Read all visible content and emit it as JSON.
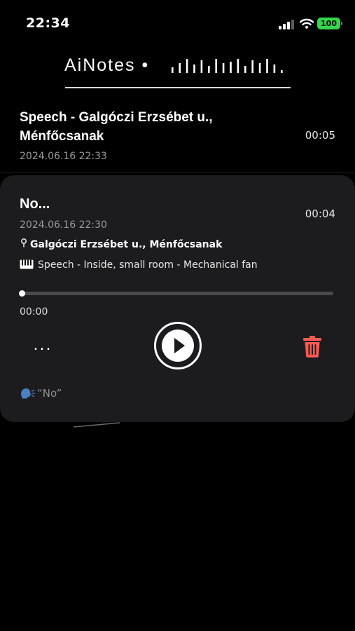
{
  "status_bar": {
    "time": "22:34",
    "battery": "100",
    "signal_icon": "cellular-signal-icon",
    "wifi_icon": "wifi-icon",
    "battery_color": "#32d74b"
  },
  "header": {
    "title": "AiNotes •",
    "wave_icon": "sound-wave-icon"
  },
  "recordings": [
    {
      "title": "Speech - Galgóczi Erzsébet u., Ménfőcsanak",
      "duration": "00:05",
      "date": "2024.06.16 22:33"
    },
    {
      "title": "No...",
      "duration": "00:04",
      "date": "2024.06.16 22:30",
      "location": "Galgóczi Erzsébet u., Ménfőcsanak",
      "location_icon": "pin-icon",
      "sound_icon": "piano-icon",
      "sound_class": "Speech - Inside, small room - Mechanical fan",
      "progress": 0,
      "elapsed": "00:00",
      "more_label": "...",
      "transcript_icon": "speaking-head-icon",
      "transcript": "“No”"
    }
  ],
  "colors": {
    "background": "#000000",
    "card": "#1c1c1e",
    "delete": "#ff5a55",
    "muted_text": "#9a9a9a"
  }
}
